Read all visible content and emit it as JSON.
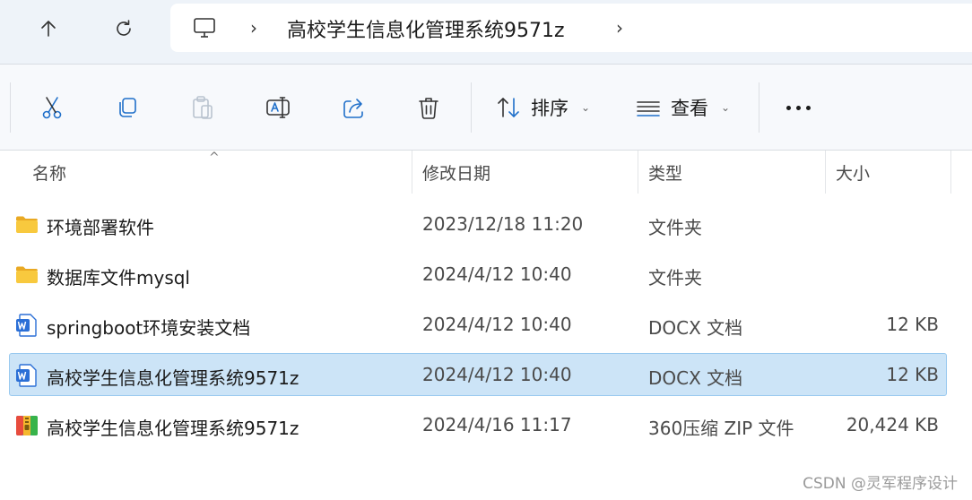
{
  "address_bar": {
    "up_icon": "arrow-up-icon",
    "refresh_icon": "refresh-icon",
    "location_icon": "this-pc-icon",
    "path": "高校学生信息化管理系统9571z",
    "separator": "›"
  },
  "toolbar": {
    "cut_icon": "scissors-icon",
    "copy_icon": "copy-icon",
    "paste_icon": "paste-icon",
    "rename_icon": "rename-icon",
    "share_icon": "share-icon",
    "delete_icon": "trash-icon",
    "sort_label": "排序",
    "view_label": "查看",
    "more_icon": "ellipsis-icon"
  },
  "columns": {
    "name": "名称",
    "date": "修改日期",
    "type": "类型",
    "size": "大小",
    "sort_indicator": "^"
  },
  "files": [
    {
      "icon": "folder-icon",
      "name": "环境部署软件",
      "date": "2023/12/18 11:20",
      "type": "文件夹",
      "size": "",
      "selected": false
    },
    {
      "icon": "folder-icon",
      "name": "数据库文件mysql",
      "date": "2024/4/12 10:40",
      "type": "文件夹",
      "size": "",
      "selected": false
    },
    {
      "icon": "word-doc-icon",
      "name": "springboot环境安装文档",
      "date": "2024/4/12 10:40",
      "type": "DOCX 文档",
      "size": "12 KB",
      "selected": false
    },
    {
      "icon": "word-doc-icon",
      "name": "高校学生信息化管理系统9571z",
      "date": "2024/4/12 10:40",
      "type": "DOCX 文档",
      "size": "12 KB",
      "selected": true
    },
    {
      "icon": "zip-archive-icon",
      "name": "高校学生信息化管理系统9571z",
      "date": "2024/4/16 11:17",
      "type": "360压缩 ZIP 文件",
      "size": "20,424 KB",
      "selected": false
    }
  ],
  "watermark": "CSDN @灵军程序设计",
  "colors": {
    "selected_row": "#cce4f7",
    "selected_border": "#99c9ef",
    "address_bg": "#eef3f9",
    "toolbar_bg": "#f7f9fc",
    "folder_yellow": "#f8c93e",
    "word_blue": "#2b6fd6"
  }
}
